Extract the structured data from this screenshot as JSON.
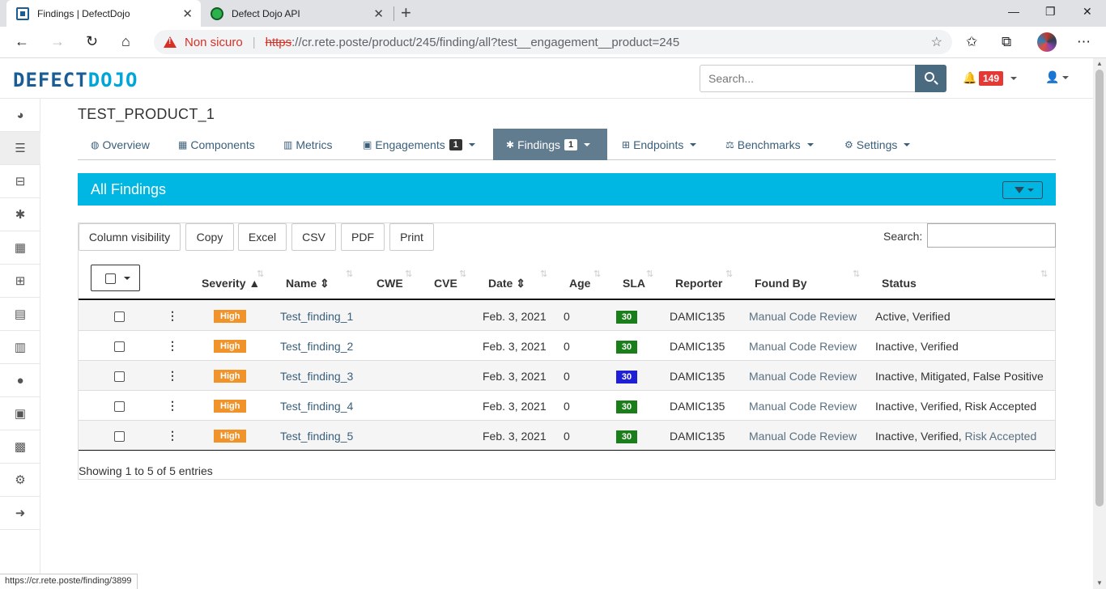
{
  "browser": {
    "tabs": [
      {
        "title": "Findings | DefectDojo",
        "active": true
      },
      {
        "title": "Defect Dojo API",
        "active": false
      }
    ],
    "omnibox": {
      "security_label": "Non sicuro",
      "scheme": "https",
      "url_rest": "://cr.rete.poste/product/245/finding/all?test__engagement__product=245"
    },
    "status_url": "https://cr.rete.poste/finding/3899"
  },
  "app": {
    "logo": {
      "part1": "DEFECT",
      "part2": "DOJO"
    },
    "search_placeholder": "Search...",
    "notifications_count": "149"
  },
  "sidebar": {
    "items": [
      "dashboard-icon",
      "list-icon",
      "inbox-icon",
      "bug-icon",
      "grid-icon",
      "sitemap-icon",
      "file-icon",
      "bar-chart-icon",
      "user-icon",
      "calendar-icon",
      "building-icon",
      "gear-icon",
      "arrow-circle-right-icon"
    ]
  },
  "product": {
    "title": "TEST_PRODUCT_1",
    "tabs": {
      "overview": "Overview",
      "components": "Components",
      "metrics": "Metrics",
      "engagements": "Engagements",
      "engagements_count": "1",
      "findings": "Findings",
      "findings_count": "1",
      "endpoints": "Endpoints",
      "benchmarks": "Benchmarks",
      "settings": "Settings"
    }
  },
  "panel": {
    "title": "All Findings"
  },
  "table": {
    "buttons": {
      "column_visibility": "Column visibility",
      "copy": "Copy",
      "excel": "Excel",
      "csv": "CSV",
      "pdf": "PDF",
      "print": "Print"
    },
    "search_label": "Search:",
    "columns": {
      "severity": "Severity",
      "name": "Name",
      "cwe": "CWE",
      "cve": "CVE",
      "date": "Date",
      "age": "Age",
      "sla": "SLA",
      "reporter": "Reporter",
      "found_by": "Found By",
      "status": "Status"
    },
    "rows": [
      {
        "severity": "High",
        "name": "Test_finding_1",
        "date": "Feb. 3, 2021",
        "age": "0",
        "sla": "30",
        "sla_color": "#1a7f1a",
        "reporter": "DAMIC135",
        "found_by": "Manual Code Review",
        "status_main": "Active, Verified",
        "status_link": ""
      },
      {
        "severity": "High",
        "name": "Test_finding_2",
        "date": "Feb. 3, 2021",
        "age": "0",
        "sla": "30",
        "sla_color": "#1a7f1a",
        "reporter": "DAMIC135",
        "found_by": "Manual Code Review",
        "status_main": "Inactive, Verified",
        "status_link": ""
      },
      {
        "severity": "High",
        "name": "Test_finding_3",
        "date": "Feb. 3, 2021",
        "age": "0",
        "sla": "30",
        "sla_color": "#1f1fd6",
        "reporter": "DAMIC135",
        "found_by": "Manual Code Review",
        "status_main": "Inactive, Mitigated, False Positive",
        "status_link": ""
      },
      {
        "severity": "High",
        "name": "Test_finding_4",
        "date": "Feb. 3, 2021",
        "age": "0",
        "sla": "30",
        "sla_color": "#1a7f1a",
        "reporter": "DAMIC135",
        "found_by": "Manual Code Review",
        "status_main": "Inactive, Verified, Risk Accepted",
        "status_link": ""
      },
      {
        "severity": "High",
        "name": "Test_finding_5",
        "date": "Feb. 3, 2021",
        "age": "0",
        "sla": "30",
        "sla_color": "#1a7f1a",
        "reporter": "DAMIC135",
        "found_by": "Manual Code Review",
        "status_main": "Inactive, Verified,",
        "status_link": "Risk Accepted"
      }
    ],
    "info": "Showing 1 to 5 of 5 entries"
  }
}
